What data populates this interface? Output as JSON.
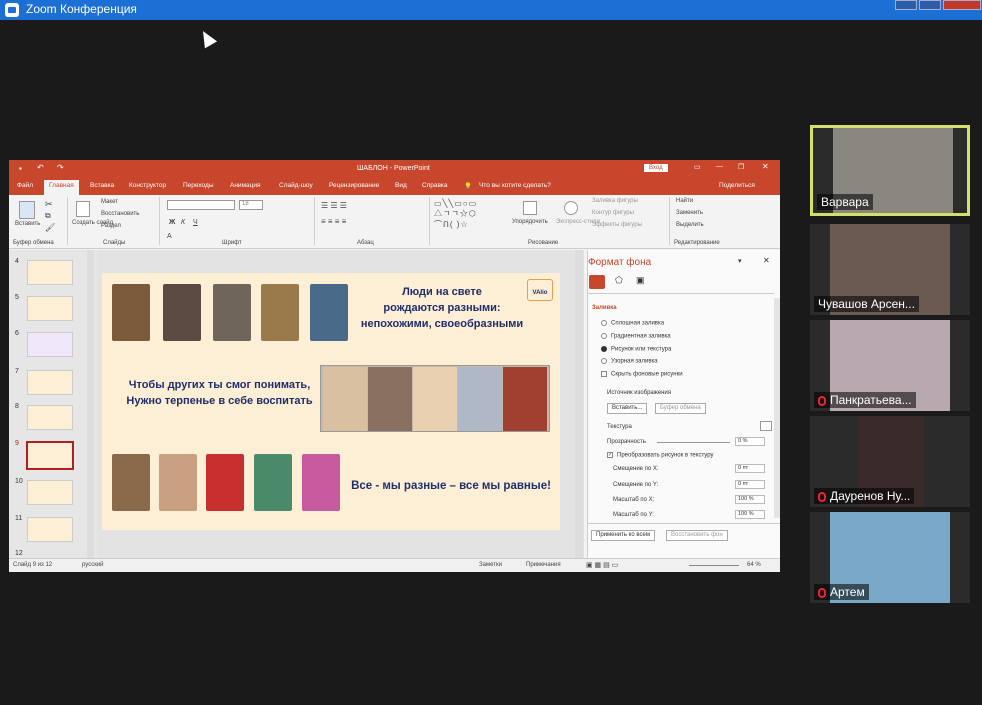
{
  "zoom": {
    "title": "Zoom Конференция"
  },
  "ppt": {
    "title": "ШАБЛОН  -  PowerPoint",
    "login": "Вход",
    "tabs": [
      "Файл",
      "Главная",
      "Вставка",
      "Конструктор",
      "Переходы",
      "Анимация",
      "Слайд-шоу",
      "Рецензирование",
      "Вид",
      "Справка",
      "Что вы хотите сделать?"
    ],
    "share": "Поделиться",
    "ribbon": {
      "paste": "Вставить",
      "create_slide": "Создать слайд",
      "layout": "Макет",
      "reset": "Восстановить",
      "section": "Раздел",
      "font_size": "18",
      "arrange": "Упорядочить",
      "quick_styles": "Экспресс-стили",
      "shape_fill": "Заливка фигуры",
      "shape_outline": "Контур фигуры",
      "shape_effects": "Эффекты фигуры",
      "find": "Найти",
      "replace": "Заменить",
      "select": "Выделить",
      "groups": [
        "Буфер обмена",
        "Слайды",
        "Шрифт",
        "Абзац",
        "Рисование",
        "Редактирование"
      ]
    },
    "thumbnails": [
      "4",
      "5",
      "6",
      "7",
      "8",
      "9",
      "10",
      "11",
      "12"
    ],
    "slide": {
      "line1a": "Люди на свете",
      "line1b": "рождаются разными:",
      "line1c": "непохожими, своеобразными",
      "line2a": "Чтобы других ты смог понимать,",
      "line2b": "Нужно терпенье в себе воспитать",
      "line3": "Все -  мы разные – все мы равные!",
      "logo": "VAlio"
    },
    "pane": {
      "title": "Формат фона",
      "section": "Заливка",
      "options": [
        "Сплошная заливка",
        "Градиентная заливка",
        "Рисунок или текстура",
        "Узорная заливка"
      ],
      "hide_bg": "Скрыть фоновые рисунки",
      "source": "Источник изображения",
      "insert_btn": "Вставить...",
      "clipboard_btn": "Буфер обмена",
      "texture": "Текстура",
      "transparency": "Прозрачность",
      "transparency_val": "0 %",
      "tile_chk": "Преобразовать рисунок в текстуру",
      "offset_x": "Смещение по X:",
      "offset_x_val": "0 пт",
      "offset_y": "Смещение по Y:",
      "offset_y_val": "0 пт",
      "scale_x": "Масштаб по X:",
      "scale_x_val": "100 %",
      "scale_y": "Масштаб по Y:",
      "scale_y_val": "100 %",
      "apply_all": "Применить ко всем",
      "reset_bg": "Восстановить фон"
    },
    "status": {
      "slide": "Слайд 9 из 12",
      "lang": "русский",
      "notes": "Заметки",
      "comments": "Примечания",
      "zoom": "64 %"
    }
  },
  "participants": [
    {
      "name": "Варвара",
      "muted": false
    },
    {
      "name": "Чувашов Арсен...",
      "muted": false
    },
    {
      "name": "Панкратьева...",
      "muted": true
    },
    {
      "name": "Дауренов Ну...",
      "muted": true
    },
    {
      "name": "Артем",
      "muted": true
    }
  ]
}
